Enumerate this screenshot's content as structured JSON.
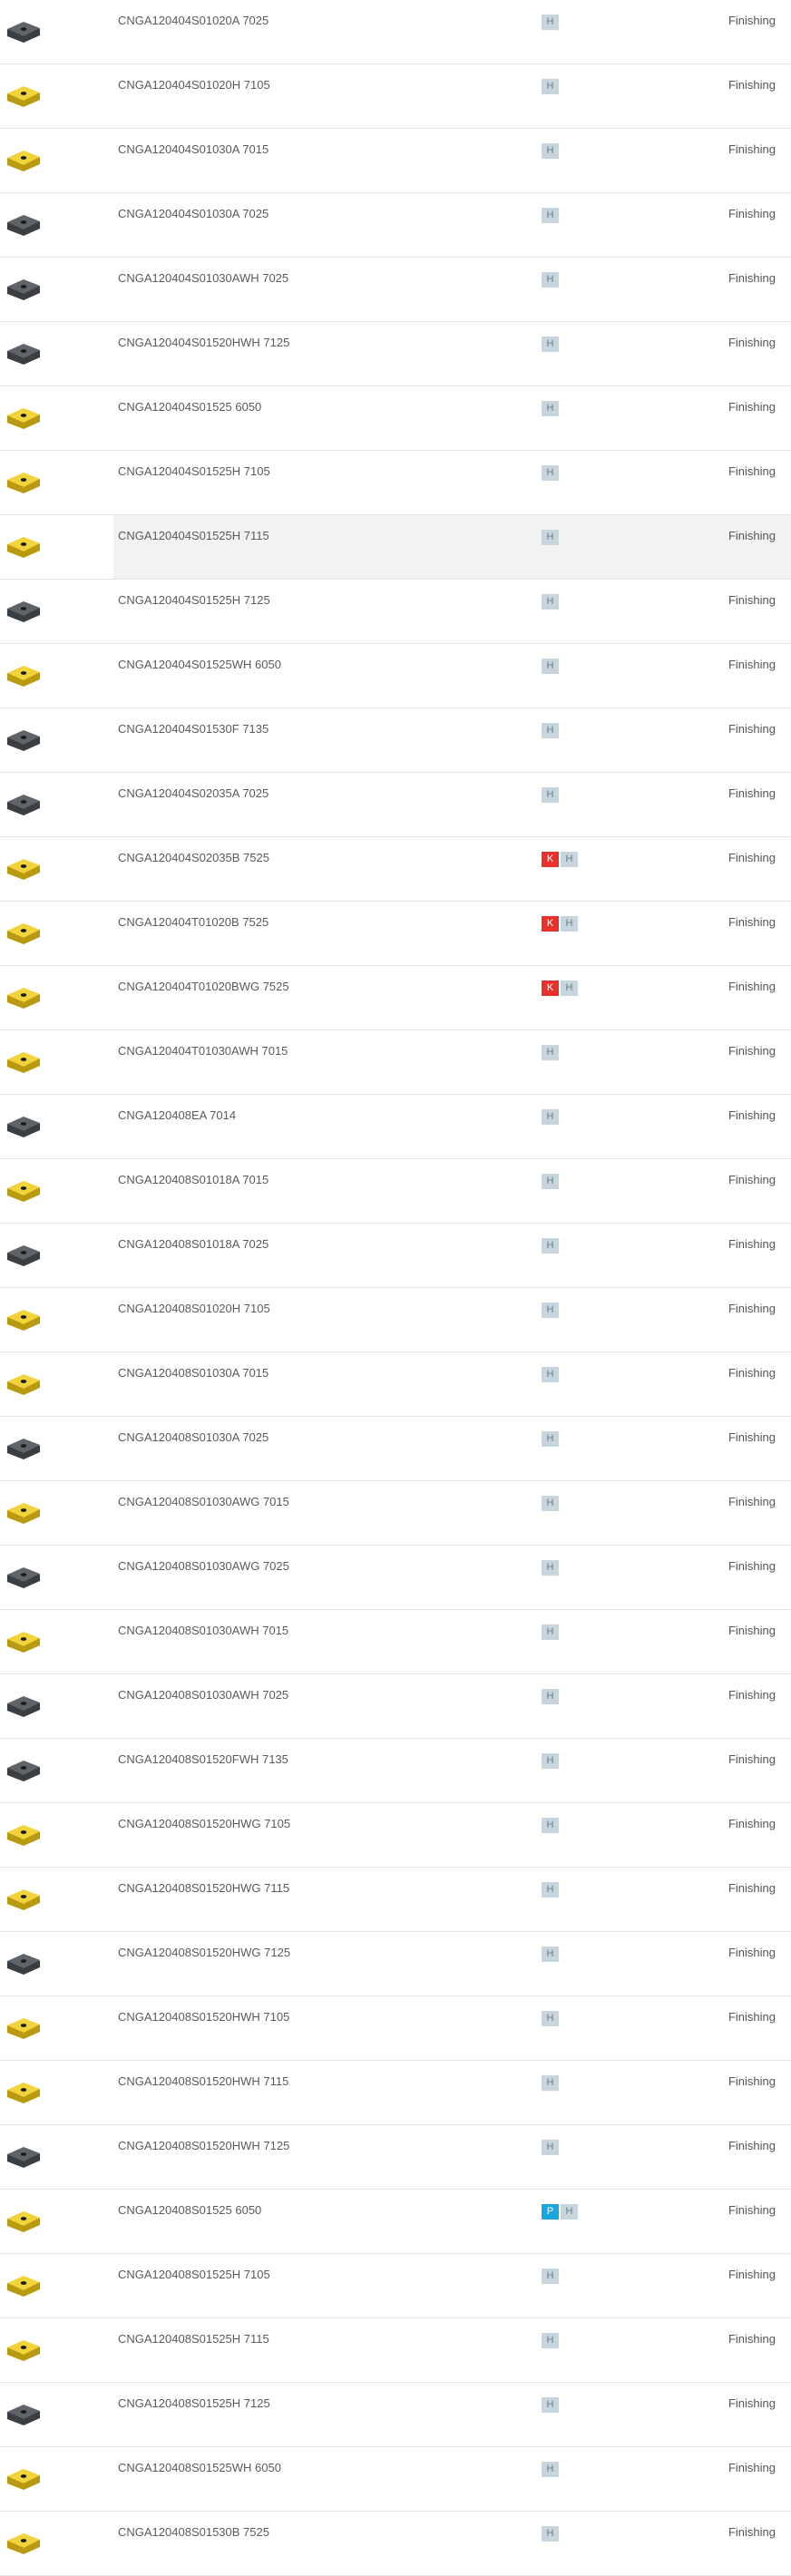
{
  "colors": {
    "insert_gray": "#5f646a",
    "insert_yellow": "#f1d43a",
    "badge_H": "#c7d6de",
    "badge_K": "#e8312a",
    "badge_P": "#1aa7e0",
    "row_highlight": "#f2f2f2"
  },
  "rows": [
    {
      "name": "CNGA120404S01020A 7025",
      "color": "gray",
      "materials": [
        "H"
      ],
      "application": "Finishing"
    },
    {
      "name": "CNGA120404S01020H 7105",
      "color": "yellow",
      "materials": [
        "H"
      ],
      "application": "Finishing"
    },
    {
      "name": "CNGA120404S01030A 7015",
      "color": "yellow",
      "materials": [
        "H"
      ],
      "application": "Finishing"
    },
    {
      "name": "CNGA120404S01030A 7025",
      "color": "gray",
      "materials": [
        "H"
      ],
      "application": "Finishing"
    },
    {
      "name": "CNGA120404S01030AWH 7025",
      "color": "gray",
      "materials": [
        "H"
      ],
      "application": "Finishing"
    },
    {
      "name": "CNGA120404S01520HWH 7125",
      "color": "gray",
      "materials": [
        "H"
      ],
      "application": "Finishing"
    },
    {
      "name": "CNGA120404S01525 6050",
      "color": "yellow",
      "materials": [
        "H"
      ],
      "application": "Finishing"
    },
    {
      "name": "CNGA120404S01525H 7105",
      "color": "yellow",
      "materials": [
        "H"
      ],
      "application": "Finishing"
    },
    {
      "name": "CNGA120404S01525H 7115",
      "color": "yellow",
      "materials": [
        "H"
      ],
      "application": "Finishing",
      "highlight": true
    },
    {
      "name": "CNGA120404S01525H 7125",
      "color": "gray",
      "materials": [
        "H"
      ],
      "application": "Finishing"
    },
    {
      "name": "CNGA120404S01525WH 6050",
      "color": "yellow",
      "materials": [
        "H"
      ],
      "application": "Finishing"
    },
    {
      "name": "CNGA120404S01530F 7135",
      "color": "gray",
      "materials": [
        "H"
      ],
      "application": "Finishing"
    },
    {
      "name": "CNGA120404S02035A 7025",
      "color": "gray",
      "materials": [
        "H"
      ],
      "application": "Finishing"
    },
    {
      "name": "CNGA120404S02035B 7525",
      "color": "yellow",
      "materials": [
        "K",
        "H"
      ],
      "application": "Finishing"
    },
    {
      "name": "CNGA120404T01020B 7525",
      "color": "yellow",
      "materials": [
        "K",
        "H"
      ],
      "application": "Finishing"
    },
    {
      "name": "CNGA120404T01020BWG 7525",
      "color": "yellow",
      "materials": [
        "K",
        "H"
      ],
      "application": "Finishing"
    },
    {
      "name": "CNGA120404T01030AWH 7015",
      "color": "yellow",
      "materials": [
        "H"
      ],
      "application": "Finishing"
    },
    {
      "name": "CNGA120408EA 7014",
      "color": "gray",
      "materials": [
        "H"
      ],
      "application": "Finishing"
    },
    {
      "name": "CNGA120408S01018A 7015",
      "color": "yellow",
      "materials": [
        "H"
      ],
      "application": "Finishing"
    },
    {
      "name": "CNGA120408S01018A 7025",
      "color": "gray",
      "materials": [
        "H"
      ],
      "application": "Finishing"
    },
    {
      "name": "CNGA120408S01020H 7105",
      "color": "yellow",
      "materials": [
        "H"
      ],
      "application": "Finishing"
    },
    {
      "name": "CNGA120408S01030A 7015",
      "color": "yellow",
      "materials": [
        "H"
      ],
      "application": "Finishing"
    },
    {
      "name": "CNGA120408S01030A 7025",
      "color": "gray",
      "materials": [
        "H"
      ],
      "application": "Finishing"
    },
    {
      "name": "CNGA120408S01030AWG 7015",
      "color": "yellow",
      "materials": [
        "H"
      ],
      "application": "Finishing"
    },
    {
      "name": "CNGA120408S01030AWG 7025",
      "color": "gray",
      "materials": [
        "H"
      ],
      "application": "Finishing"
    },
    {
      "name": "CNGA120408S01030AWH 7015",
      "color": "yellow",
      "materials": [
        "H"
      ],
      "application": "Finishing"
    },
    {
      "name": "CNGA120408S01030AWH 7025",
      "color": "gray",
      "materials": [
        "H"
      ],
      "application": "Finishing"
    },
    {
      "name": "CNGA120408S01520FWH 7135",
      "color": "gray",
      "materials": [
        "H"
      ],
      "application": "Finishing"
    },
    {
      "name": "CNGA120408S01520HWG 7105",
      "color": "yellow",
      "materials": [
        "H"
      ],
      "application": "Finishing"
    },
    {
      "name": "CNGA120408S01520HWG 7115",
      "color": "yellow",
      "materials": [
        "H"
      ],
      "application": "Finishing"
    },
    {
      "name": "CNGA120408S01520HWG 7125",
      "color": "gray",
      "materials": [
        "H"
      ],
      "application": "Finishing"
    },
    {
      "name": "CNGA120408S01520HWH 7105",
      "color": "yellow",
      "materials": [
        "H"
      ],
      "application": "Finishing"
    },
    {
      "name": "CNGA120408S01520HWH 7115",
      "color": "yellow",
      "materials": [
        "H"
      ],
      "application": "Finishing"
    },
    {
      "name": "CNGA120408S01520HWH 7125",
      "color": "gray",
      "materials": [
        "H"
      ],
      "application": "Finishing"
    },
    {
      "name": "CNGA120408S01525 6050",
      "color": "yellow",
      "materials": [
        "P",
        "H"
      ],
      "application": "Finishing"
    },
    {
      "name": "CNGA120408S01525H 7105",
      "color": "yellow",
      "materials": [
        "H"
      ],
      "application": "Finishing"
    },
    {
      "name": "CNGA120408S01525H 7115",
      "color": "yellow",
      "materials": [
        "H"
      ],
      "application": "Finishing"
    },
    {
      "name": "CNGA120408S01525H 7125",
      "color": "gray",
      "materials": [
        "H"
      ],
      "application": "Finishing"
    },
    {
      "name": "CNGA120408S01525WH 6050",
      "color": "yellow",
      "materials": [
        "H"
      ],
      "application": "Finishing"
    },
    {
      "name": "CNGA120408S01530B 7525",
      "color": "yellow",
      "materials": [
        "H"
      ],
      "application": "Finishing"
    }
  ]
}
